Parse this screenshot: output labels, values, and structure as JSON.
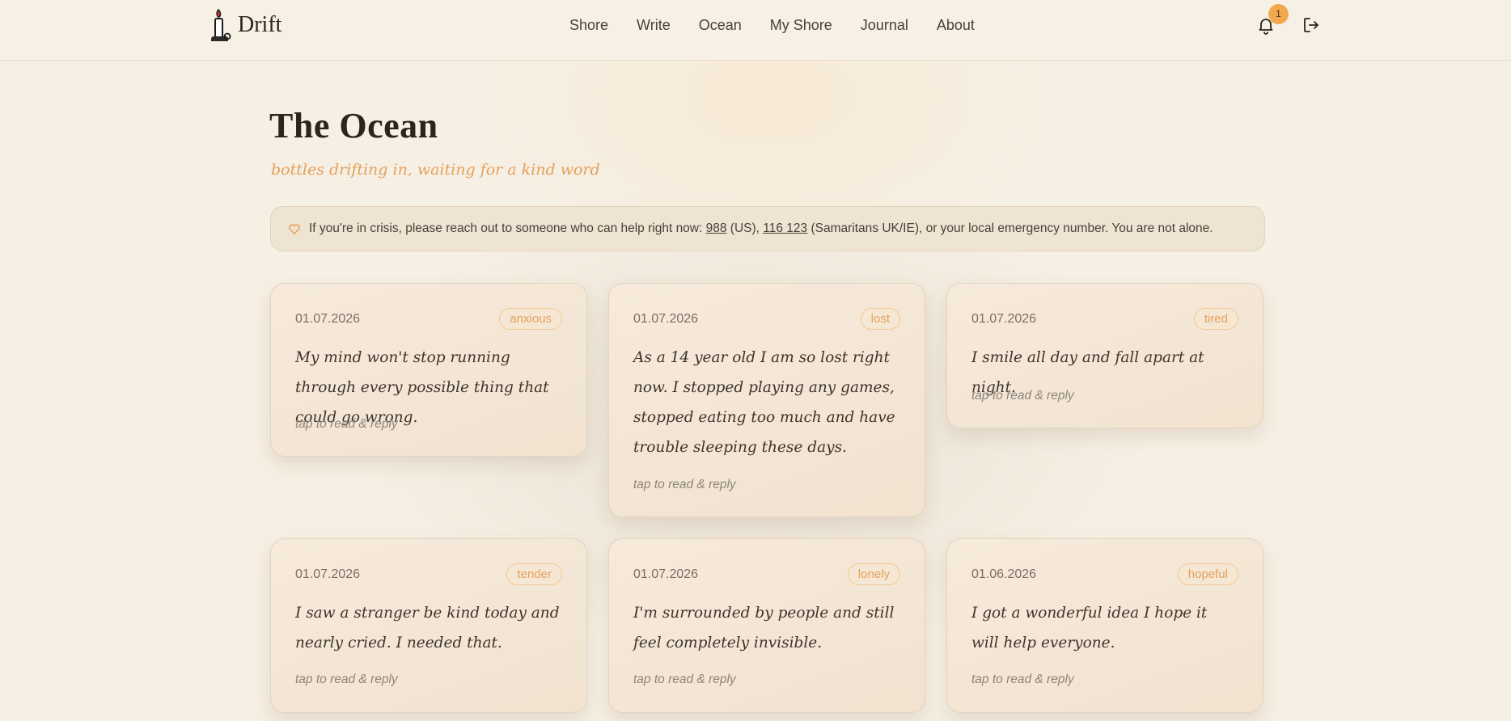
{
  "app": {
    "name": "Drift"
  },
  "nav": {
    "items": [
      "Shore",
      "Write",
      "Ocean",
      "My Shore",
      "Journal",
      "About"
    ]
  },
  "header": {
    "notification_count": "1",
    "icons": [
      "candle-logo-icon",
      "bell-icon",
      "logout-icon"
    ]
  },
  "page": {
    "title": "The Ocean",
    "subtitle": "bottles drifting in, waiting for a kind word"
  },
  "crisis": {
    "text_before": "If you're in crisis, please reach out to someone who can help right now: ",
    "phone_us": "988",
    "text_us": " (US), ",
    "phone_uk": "116 123",
    "text_after": " (Samaritans UK/IE), or your local emergency number. You are not alone.",
    "icon": "heart-icon"
  },
  "cards": [
    {
      "date": "01.07.2026",
      "mood": "anxious",
      "message": "My mind won't stop running through every possible thing that could go wrong.",
      "hint": "tap to read & reply"
    },
    {
      "date": "01.07.2026",
      "mood": "lost",
      "message": "As a 14 year old I am so lost right now. I stopped playing any games, stopped eating too much and have trouble sleeping these days.",
      "hint": "tap to read & reply"
    },
    {
      "date": "01.07.2026",
      "mood": "tired",
      "message": "I smile all day and fall apart at night.",
      "hint": "tap to read & reply"
    },
    {
      "date": "01.07.2026",
      "mood": "tender",
      "message": "I saw a stranger be kind today and nearly cried. I needed that.",
      "hint": "tap to read & reply"
    },
    {
      "date": "01.07.2026",
      "mood": "lonely",
      "message": "I'm surrounded by people and still feel completely invisible.",
      "hint": "tap to read & reply"
    },
    {
      "date": "01.06.2026",
      "mood": "hopeful",
      "message": "I got a wonderful idea I hope it will help everyone.",
      "hint": "tap to read & reply"
    }
  ],
  "colors": {
    "background": "#f6efe3",
    "accent": "#f2a94e",
    "mood_text": "#e5a05b",
    "card_border": "#e4d3bd"
  }
}
